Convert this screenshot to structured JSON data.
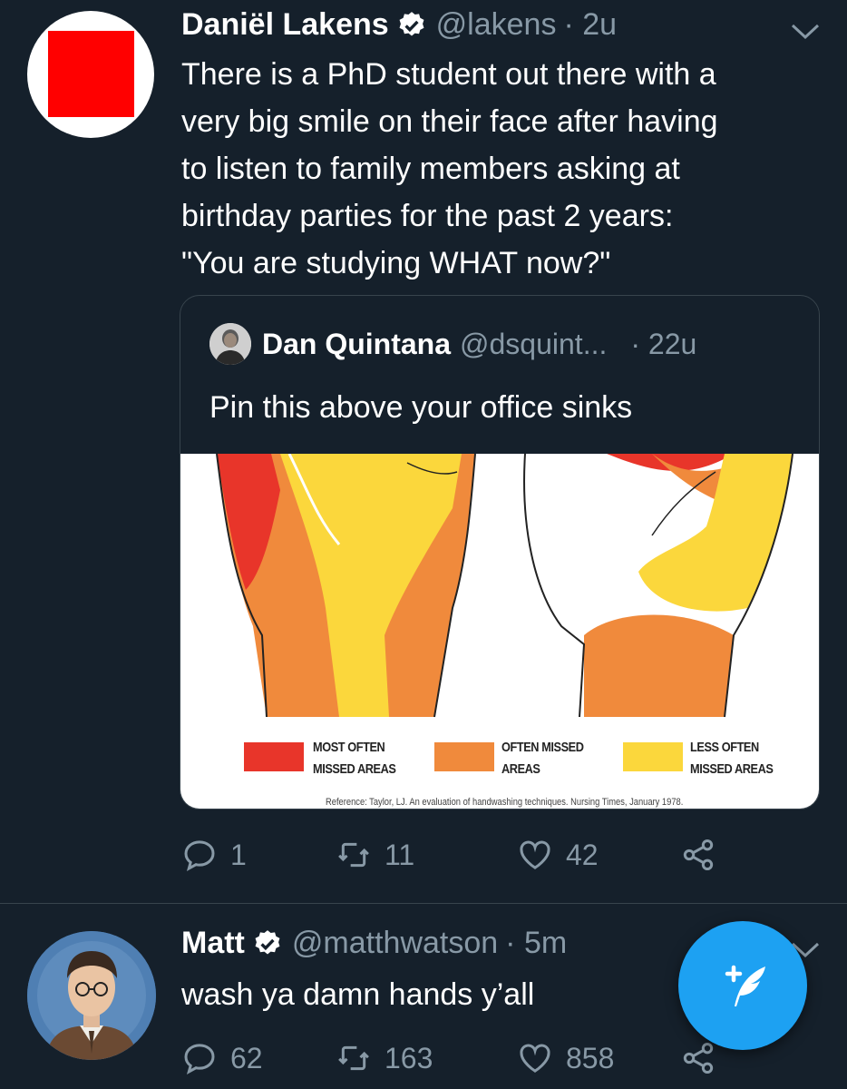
{
  "tweet1": {
    "author_name": "Daniël Lakens",
    "author_handle": "@lakens",
    "time": "· 2u",
    "text": "There is a PhD student out there with a\nvery big smile on their face after having\nto listen to family members asking at\nbirthday parties for the past 2 years:\n\"You are studying WHAT now?\"",
    "quoted": {
      "author_name": "Dan Quintana",
      "author_handle": "@dsquint...",
      "time": "· 22u",
      "text": "Pin this above your office sinks",
      "image": {
        "legend": [
          {
            "label": "MOST OFTEN\nMISSED AREAS",
            "color": "#e8352a"
          },
          {
            "label": "OFTEN MISSED\nAREAS",
            "color": "#f08a3c"
          },
          {
            "label": "LESS OFTEN\nMISSED AREAS",
            "color": "#fbd73c"
          }
        ],
        "reference": "Reference: Taylor, LJ. An evaluation of handwashing techniques. Nursing Times, January 1978."
      }
    },
    "actions": {
      "replies": "1",
      "retweets": "11",
      "likes": "42"
    }
  },
  "tweet2": {
    "author_name": "Matt",
    "author_handle": "@matthwatson",
    "time": "· 5m",
    "text": "wash ya damn hands y’all",
    "actions": {
      "replies": "62",
      "retweets": "163",
      "likes": "858"
    }
  },
  "colors": {
    "background": "#15202b",
    "secondary_text": "#8899a6",
    "accent": "#1da1f2",
    "border": "#38444d"
  },
  "icons": [
    "verified-badge-icon",
    "chevron-down-icon",
    "reply-icon",
    "retweet-icon",
    "like-icon",
    "share-icon",
    "compose-tweet-icon"
  ]
}
